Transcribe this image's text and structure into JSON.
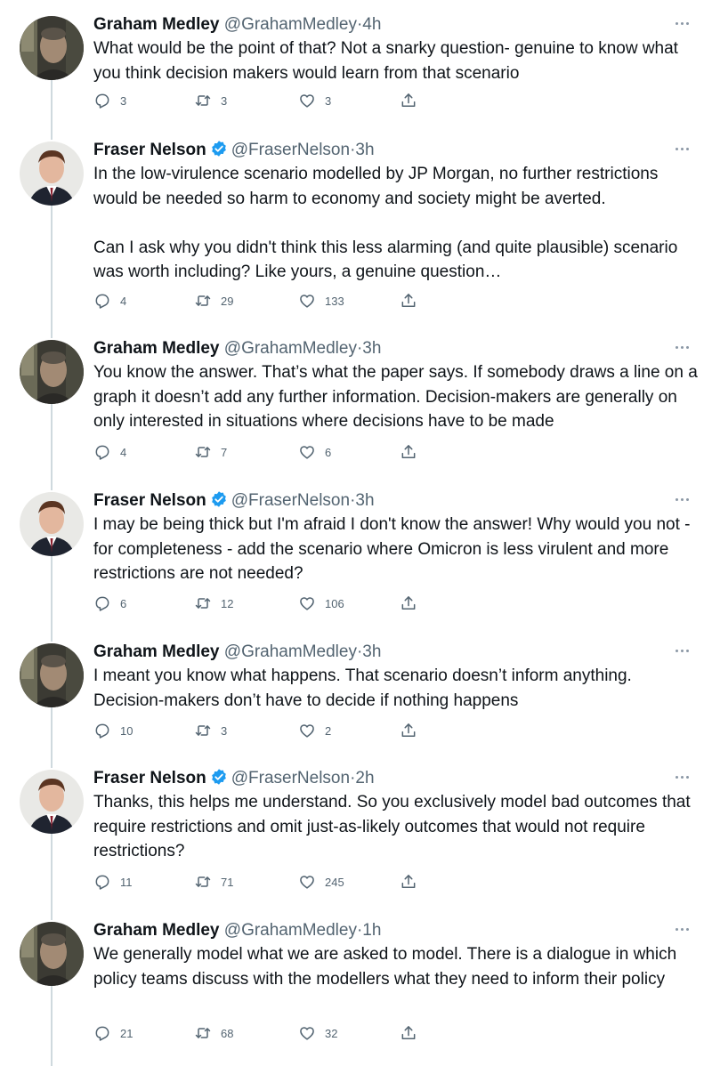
{
  "colors": {
    "text": "#0f1419",
    "secondary": "#536471",
    "verified": "#1d9bf0",
    "thread_line": "#cfd9de"
  },
  "icons": {
    "reply": "reply-icon",
    "retweet": "retweet-icon",
    "like": "like-icon",
    "share": "share-icon",
    "verified": "verified-badge-icon",
    "more": "more-options-icon"
  },
  "tweets": [
    {
      "name": "Graham Medley",
      "verified": false,
      "handle": "@GrahamMedley",
      "time": "4h",
      "paragraphs": [
        "What would be the point of that? Not a snarky question- genuine to know what you think decision makers would learn from that scenario"
      ],
      "replies": "3",
      "retweets": "3",
      "likes": "3"
    },
    {
      "name": "Fraser Nelson",
      "verified": true,
      "handle": "@FraserNelson",
      "time": "3h",
      "paragraphs": [
        "In the low-virulence scenario modelled by JP Morgan, no further restrictions would be needed so harm to economy and society might be averted.",
        "Can I ask why you didn't think this less alarming (and quite plausible) scenario was worth including? Like yours, a genuine question…"
      ],
      "replies": "4",
      "retweets": "29",
      "likes": "133"
    },
    {
      "name": "Graham Medley",
      "verified": false,
      "handle": "@GrahamMedley",
      "time": "3h",
      "paragraphs": [
        "You know the answer. That’s what the paper says. If somebody draws a line on a graph it doesn’t add any further information. Decision-makers are generally on only interested in situations where decisions have to be made"
      ],
      "replies": "4",
      "retweets": "7",
      "likes": "6"
    },
    {
      "name": "Fraser Nelson",
      "verified": true,
      "handle": "@FraserNelson",
      "time": "3h",
      "paragraphs": [
        "I may be being thick but I'm afraid I don't know the answer! Why would you not - for completeness - add the scenario where Omicron is less virulent and more restrictions are not needed?"
      ],
      "replies": "6",
      "retweets": "12",
      "likes": "106"
    },
    {
      "name": "Graham Medley",
      "verified": false,
      "handle": "@GrahamMedley",
      "time": "3h",
      "paragraphs": [
        "I meant you know what happens. That scenario doesn’t inform anything. Decision-makers don’t have to decide if nothing happens"
      ],
      "replies": "10",
      "retweets": "3",
      "likes": "2"
    },
    {
      "name": "Fraser Nelson",
      "verified": true,
      "handle": "@FraserNelson",
      "time": "2h",
      "paragraphs": [
        "Thanks, this helps me understand. So you exclusively model bad outcomes that require restrictions and omit just-as-likely outcomes that would not require restrictions?"
      ],
      "replies": "11",
      "retweets": "71",
      "likes": "245"
    },
    {
      "name": "Graham Medley",
      "verified": false,
      "handle": "@GrahamMedley",
      "time": "1h",
      "paragraphs": [
        "We generally model what we are asked to model. There is a dialogue in which policy teams discuss with the modellers what they need to inform their policy"
      ],
      "replies": "21",
      "retweets": "68",
      "likes": "32"
    }
  ]
}
